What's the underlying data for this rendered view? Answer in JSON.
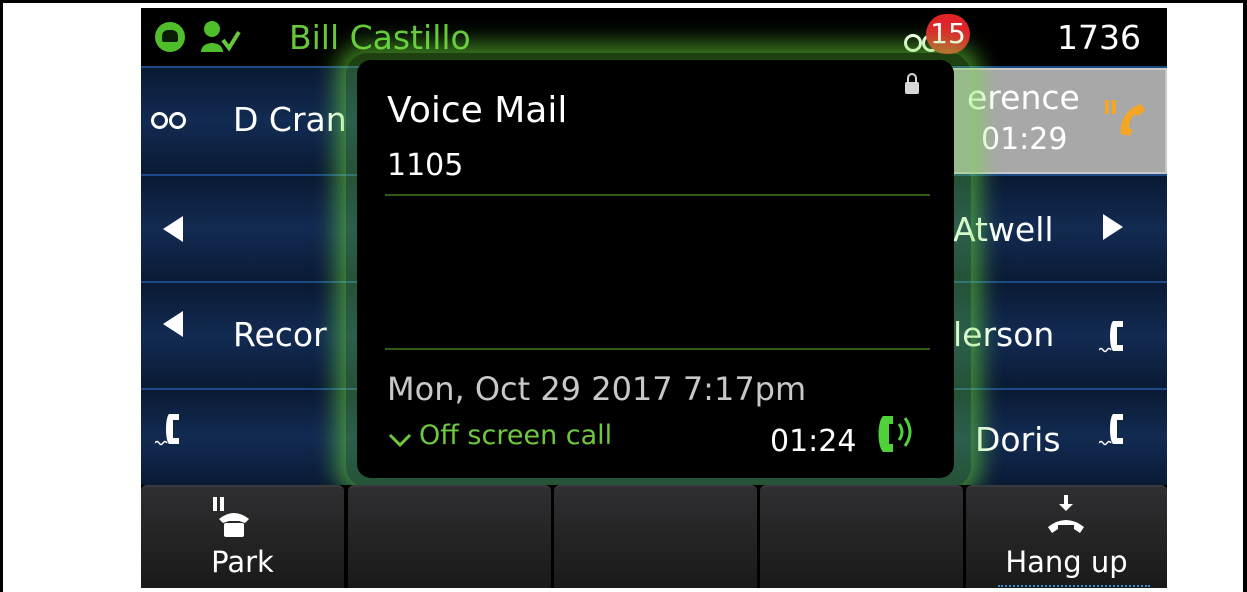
{
  "status_bar": {
    "user_name": "Bill Castillo",
    "voicemail_count": "15",
    "extension": "1736",
    "icons": [
      "phone-status-icon",
      "user-presence-icon",
      "voicemail-icon"
    ]
  },
  "line_keys": {
    "row1_left_text": "D Cran",
    "row1_right_label": "erence",
    "row1_right_timer": "01:29",
    "row2_right_text": "Atwell",
    "row3_left_text": "Recor",
    "row3_right_text": "lerson",
    "row4_right_text": "Doris"
  },
  "popup": {
    "title": "Voice Mail",
    "number": "1105",
    "date": "Mon, Oct 29 2017 7:17pm",
    "status": "Off screen call",
    "timer": "01:24"
  },
  "softkeys": [
    {
      "label": "Park",
      "icon": "park-icon"
    },
    {
      "label": ""
    },
    {
      "label": ""
    },
    {
      "label": ""
    },
    {
      "label": "Hang up",
      "icon": "hang-up-icon"
    }
  ],
  "colors": {
    "accent_green": "#6fc83e",
    "badge_red": "#e0242a",
    "hold_orange": "#f5a623",
    "row_blue": "#122b52"
  }
}
